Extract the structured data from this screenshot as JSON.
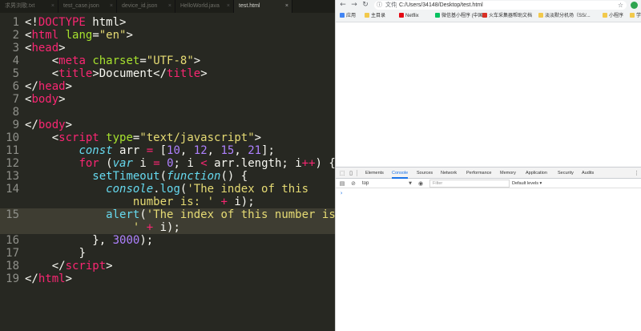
{
  "editor": {
    "tabs": [
      {
        "label": "求男浏歌.txt",
        "active": false
      },
      {
        "label": "test_case.json",
        "active": false
      },
      {
        "label": "device_id.json",
        "active": false
      },
      {
        "label": "HelloWorld.java",
        "active": false
      },
      {
        "label": "test.html",
        "active": true
      }
    ],
    "close_glyph": "×",
    "highlight_line": 15,
    "colors": {
      "background": "#272822",
      "tag": "#f92672",
      "attribute": "#a6e22e",
      "string": "#e6db74",
      "number": "#ae81ff",
      "keyword": "#66d9ef",
      "parameter": "#fd971f",
      "highlight": "#3e3d32"
    },
    "lines": [
      {
        "n": "1",
        "row": 0,
        "indent": 0,
        "segs": [
          {
            "c": "",
            "t": "<!"
          },
          {
            "c": "pk",
            "t": "DOCTYPE"
          },
          {
            "c": "",
            "t": " html>"
          }
        ]
      },
      {
        "n": "2",
        "row": 1,
        "indent": 0,
        "segs": [
          {
            "c": "",
            "t": "<"
          },
          {
            "c": "pk",
            "t": "html"
          },
          {
            "c": "",
            "t": " "
          },
          {
            "c": "gr",
            "t": "lang"
          },
          {
            "c": "",
            "t": "="
          },
          {
            "c": "ye",
            "t": "\"en\""
          },
          {
            "c": "",
            "t": ">"
          }
        ]
      },
      {
        "n": "3",
        "row": 2,
        "indent": 0,
        "segs": [
          {
            "c": "",
            "t": "<"
          },
          {
            "c": "pk",
            "t": "head"
          },
          {
            "c": "",
            "t": ">"
          }
        ]
      },
      {
        "n": "4",
        "row": 3,
        "indent": 4,
        "segs": [
          {
            "c": "",
            "t": "<"
          },
          {
            "c": "pk",
            "t": "meta"
          },
          {
            "c": "",
            "t": " "
          },
          {
            "c": "gr",
            "t": "charset"
          },
          {
            "c": "",
            "t": "="
          },
          {
            "c": "ye",
            "t": "\"UTF-8\""
          },
          {
            "c": "",
            "t": ">"
          }
        ]
      },
      {
        "n": "5",
        "row": 4,
        "indent": 4,
        "segs": [
          {
            "c": "",
            "t": "<"
          },
          {
            "c": "pk",
            "t": "title"
          },
          {
            "c": "",
            "t": ">Document</"
          },
          {
            "c": "pk",
            "t": "title"
          },
          {
            "c": "",
            "t": ">"
          }
        ]
      },
      {
        "n": "6",
        "row": 5,
        "indent": 0,
        "segs": [
          {
            "c": "",
            "t": "</"
          },
          {
            "c": "pk",
            "t": "head"
          },
          {
            "c": "",
            "t": ">"
          }
        ]
      },
      {
        "n": "7",
        "row": 6,
        "indent": 0,
        "segs": [
          {
            "c": "",
            "t": "<"
          },
          {
            "c": "pk",
            "t": "body"
          },
          {
            "c": "",
            "t": ">"
          }
        ]
      },
      {
        "n": "8",
        "row": 7,
        "indent": 0,
        "segs": []
      },
      {
        "n": "9",
        "row": 8,
        "indent": 0,
        "segs": [
          {
            "c": "",
            "t": "</"
          },
          {
            "c": "pk",
            "t": "body"
          },
          {
            "c": "",
            "t": ">"
          }
        ]
      },
      {
        "n": "10",
        "row": 9,
        "indent": 4,
        "segs": [
          {
            "c": "",
            "t": "<"
          },
          {
            "c": "pk",
            "t": "script"
          },
          {
            "c": "",
            "t": " "
          },
          {
            "c": "gr",
            "t": "type"
          },
          {
            "c": "",
            "t": "="
          },
          {
            "c": "ye",
            "t": "\"text/javascript\""
          },
          {
            "c": "",
            "t": ">"
          }
        ]
      },
      {
        "n": "11",
        "row": 10,
        "indent": 8,
        "segs": [
          {
            "c": "ci",
            "t": "const"
          },
          {
            "c": "",
            "t": " arr "
          },
          {
            "c": "pk",
            "t": "="
          },
          {
            "c": "",
            "t": " ["
          },
          {
            "c": "pu",
            "t": "10"
          },
          {
            "c": "",
            "t": ", "
          },
          {
            "c": "pu",
            "t": "12"
          },
          {
            "c": "",
            "t": ", "
          },
          {
            "c": "pu",
            "t": "15"
          },
          {
            "c": "",
            "t": ", "
          },
          {
            "c": "pu",
            "t": "21"
          },
          {
            "c": "",
            "t": "];"
          }
        ]
      },
      {
        "n": "12",
        "row": 11,
        "indent": 8,
        "segs": [
          {
            "c": "pk",
            "t": "for"
          },
          {
            "c": "",
            "t": " ("
          },
          {
            "c": "ci",
            "t": "var"
          },
          {
            "c": "",
            "t": " i "
          },
          {
            "c": "pk",
            "t": "="
          },
          {
            "c": "",
            "t": " "
          },
          {
            "c": "pu",
            "t": "0"
          },
          {
            "c": "",
            "t": "; i "
          },
          {
            "c": "pk",
            "t": "<"
          },
          {
            "c": "",
            "t": " arr.length; i"
          },
          {
            "c": "pk",
            "t": "++"
          },
          {
            "c": "",
            "t": ") {"
          }
        ]
      },
      {
        "n": "13",
        "row": 12,
        "indent": 10,
        "segs": [
          {
            "c": "cy",
            "t": "setTimeout"
          },
          {
            "c": "",
            "t": "("
          },
          {
            "c": "ci",
            "t": "function"
          },
          {
            "c": "",
            "t": "() {"
          }
        ]
      },
      {
        "n": "14",
        "row": 13,
        "indent": 12,
        "segs": [
          {
            "c": "ci",
            "t": "console"
          },
          {
            "c": "",
            "t": "."
          },
          {
            "c": "cy",
            "t": "log"
          },
          {
            "c": "",
            "t": "("
          },
          {
            "c": "ye",
            "t": "'The index of this"
          }
        ]
      },
      {
        "n": "",
        "row": 14,
        "indent": 16,
        "segs": [
          {
            "c": "ye",
            "t": "number is: '"
          },
          {
            "c": "",
            "t": " "
          },
          {
            "c": "pk",
            "t": "+"
          },
          {
            "c": "",
            "t": " i);"
          }
        ]
      },
      {
        "n": "15",
        "row": 15,
        "indent": 12,
        "segs": [
          {
            "c": "cy",
            "t": "alert"
          },
          {
            "c": "",
            "t": "("
          },
          {
            "c": "ye",
            "t": "'The index of this number is:"
          }
        ]
      },
      {
        "n": "",
        "row": 16,
        "indent": 16,
        "segs": [
          {
            "c": "ye",
            "t": "'"
          },
          {
            "c": "",
            "t": " "
          },
          {
            "c": "pk",
            "t": "+"
          },
          {
            "c": "",
            "t": " i);"
          }
        ]
      },
      {
        "n": "16",
        "row": 17,
        "indent": 10,
        "segs": [
          {
            "c": "",
            "t": "}, "
          },
          {
            "c": "pu",
            "t": "3000"
          },
          {
            "c": "",
            "t": ");"
          }
        ]
      },
      {
        "n": "17",
        "row": 18,
        "indent": 8,
        "segs": [
          {
            "c": "",
            "t": "}"
          }
        ]
      },
      {
        "n": "18",
        "row": 19,
        "indent": 4,
        "segs": [
          {
            "c": "",
            "t": "</"
          },
          {
            "c": "pk",
            "t": "script"
          },
          {
            "c": "",
            "t": ">"
          }
        ]
      },
      {
        "n": "19",
        "row": 20,
        "indent": 0,
        "segs": [
          {
            "c": "",
            "t": "</"
          },
          {
            "c": "pk",
            "t": "html"
          },
          {
            "c": "",
            "t": ">"
          }
        ]
      }
    ]
  },
  "browser": {
    "nav": {
      "back": "←",
      "forward": "→",
      "reload": "↻"
    },
    "omnibox": {
      "info_glyph": "ⓘ",
      "label": "文件",
      "url": "C:/Users/34148/Desktop/test.html",
      "star_glyph": "☆"
    },
    "bookmarks": [
      {
        "label": "应用",
        "color": "#4285f4"
      },
      {
        "label": "主目录",
        "color": "#f2c94c"
      },
      {
        "label": "Netflix",
        "color": "#e50914"
      },
      {
        "label": "微信基小程序 (中国...",
        "color": "#07c160"
      },
      {
        "label": "火车采集器帮助文档",
        "color": "#d93025"
      },
      {
        "label": "淡淡默分机场（SS/...",
        "color": "#f2c94c"
      },
      {
        "label": "小程序",
        "color": "#f2c94c"
      },
      {
        "label": "学习",
        "color": "#f2c94c"
      }
    ],
    "devtools": {
      "inspect_glyph": "⬚",
      "device_glyph": "▯",
      "tabs": [
        "Elements",
        "Console",
        "Sources",
        "Network",
        "Performance",
        "Memory",
        "Application",
        "Security",
        "Audits"
      ],
      "active_tab": "Console",
      "more_glyph": "⋮",
      "console_bar": {
        "sidebar_glyph": "▤",
        "clear_glyph": "⊘",
        "context": "top",
        "caret": "▼",
        "eye_glyph": "◉",
        "filter_placeholder": "Filter",
        "levels": "Default levels ▾"
      },
      "prompt": "›"
    }
  }
}
